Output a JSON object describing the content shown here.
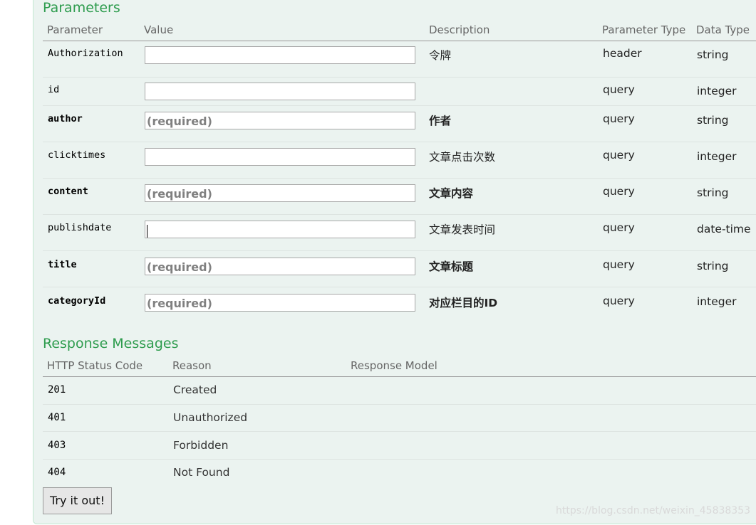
{
  "parameters": {
    "title": "Parameters",
    "headers": {
      "parameter": "Parameter",
      "value": "Value",
      "description": "Description",
      "parameter_type": "Parameter Type",
      "data_type": "Data Type"
    },
    "rows": [
      {
        "name": "Authorization",
        "required": false,
        "value": "",
        "placeholder": "",
        "description": "令牌",
        "parameter_type": "header",
        "data_type": "string"
      },
      {
        "name": "id",
        "required": false,
        "value": "",
        "placeholder": "",
        "description": "",
        "parameter_type": "query",
        "data_type": "integer"
      },
      {
        "name": "author",
        "required": true,
        "value": "",
        "placeholder": "(required)",
        "description": "作者",
        "parameter_type": "query",
        "data_type": "string"
      },
      {
        "name": "clicktimes",
        "required": false,
        "value": "",
        "placeholder": "",
        "description": "文章点击次数",
        "parameter_type": "query",
        "data_type": "integer"
      },
      {
        "name": "content",
        "required": true,
        "value": "",
        "placeholder": "(required)",
        "description": "文章内容",
        "parameter_type": "query",
        "data_type": "string"
      },
      {
        "name": "publishdate",
        "required": false,
        "value": "",
        "placeholder": "",
        "description": "文章发表时间",
        "parameter_type": "query",
        "data_type": "date-time"
      },
      {
        "name": "title",
        "required": true,
        "value": "",
        "placeholder": "(required)",
        "description": "文章标题",
        "parameter_type": "query",
        "data_type": "string"
      },
      {
        "name": "categoryId",
        "required": true,
        "value": "",
        "placeholder": "(required)",
        "description": "对应栏目的ID",
        "parameter_type": "query",
        "data_type": "integer"
      }
    ]
  },
  "responses": {
    "title": "Response Messages",
    "headers": {
      "status_code": "HTTP Status Code",
      "reason": "Reason",
      "model": "Response Model"
    },
    "rows": [
      {
        "code": "201",
        "reason": "Created"
      },
      {
        "code": "401",
        "reason": "Unauthorized"
      },
      {
        "code": "403",
        "reason": "Forbidden"
      },
      {
        "code": "404",
        "reason": "Not Found"
      }
    ]
  },
  "try_button": "Try it out!",
  "watermark": "https://blog.csdn.net/weixin_45838353",
  "colors": {
    "section_title": "#2e9c4e",
    "panel_background": "#ebf3f0",
    "panel_border": "#c3e8d1"
  }
}
